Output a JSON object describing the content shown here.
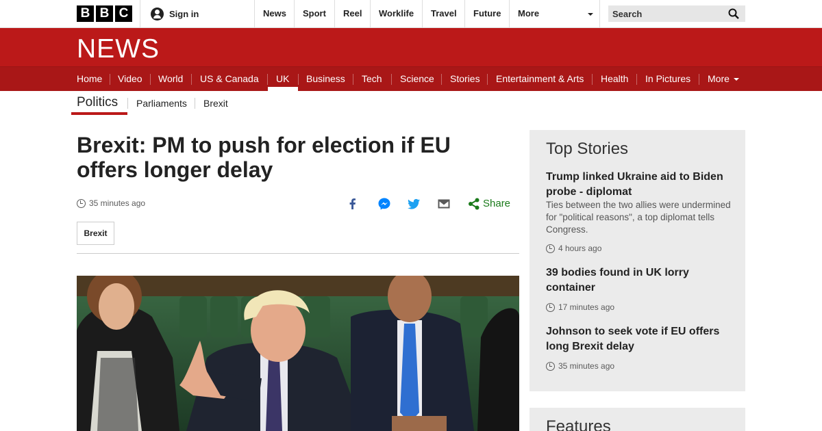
{
  "global_bar": {
    "logo_letters": [
      "B",
      "B",
      "C"
    ],
    "sign_in": "Sign in",
    "nav": [
      "News",
      "Sport",
      "Reel",
      "Worklife",
      "Travel",
      "Future",
      "More"
    ],
    "search_placeholder": "Search"
  },
  "masthead": {
    "title": "NEWS",
    "nav": [
      "Home",
      "Video",
      "World",
      "US & Canada",
      "UK",
      "Business",
      "Tech",
      "Science",
      "Stories",
      "Entertainment & Arts",
      "Health",
      "In Pictures",
      "More"
    ],
    "active": "UK"
  },
  "subnav": {
    "current": "Politics",
    "items": [
      "Parliaments",
      "Brexit"
    ]
  },
  "article": {
    "headline": "Brexit: PM to push for election if EU offers longer delay",
    "timestamp": "35 minutes ago",
    "share_label": "Share",
    "tag": "Brexit"
  },
  "sidebar": {
    "top_stories_title": "Top Stories",
    "stories": [
      {
        "title": "Trump linked Ukraine aid to Biden probe - diplomat",
        "summary": "Ties between the two allies were undermined for \"political reasons\", a top diplomat tells Congress.",
        "time": "4 hours ago"
      },
      {
        "title": "39 bodies found in UK lorry container",
        "time": "17 minutes ago"
      },
      {
        "title": "Johnson to seek vote if EU offers long Brexit delay",
        "time": "35 minutes ago"
      }
    ],
    "features_title": "Features"
  },
  "colors": {
    "brand_red": "#bb1919",
    "nav_red": "#a91717",
    "share_green": "#1a7a1a",
    "facebook_blue": "#3b5998",
    "twitter_blue": "#1da1f2",
    "messenger_blue": "#0084ff"
  }
}
